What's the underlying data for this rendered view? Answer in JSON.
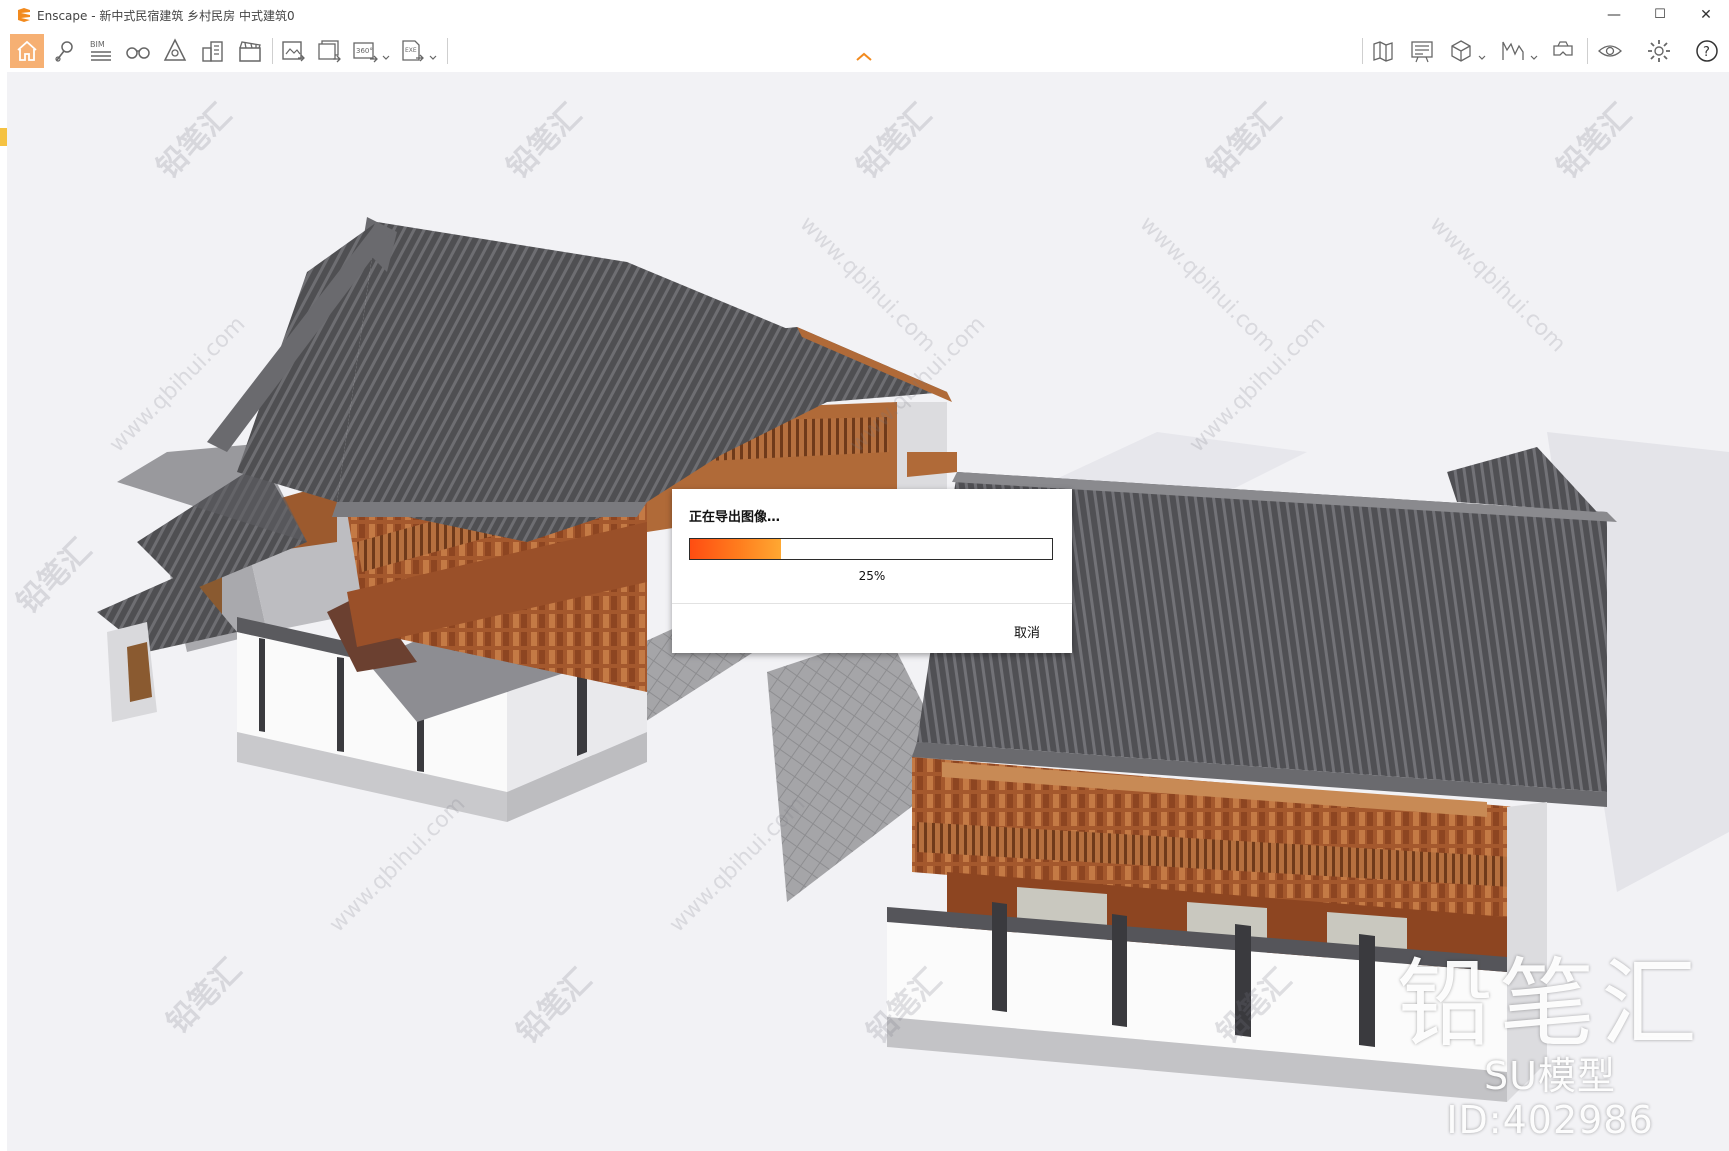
{
  "window": {
    "title": "Enscape - 新中式民宿建筑 乡村民房 中式建筑0",
    "minimize_glyph": "—",
    "maximize_glyph": "☐",
    "close_glyph": "✕"
  },
  "toolbar": {
    "items": [
      {
        "name": "home-button",
        "icon": "home-icon",
        "active": true
      },
      {
        "name": "views-button",
        "icon": "location-pin-icon"
      },
      {
        "name": "bim-button",
        "icon": "bim-icon",
        "label": "BIM"
      },
      {
        "name": "walk-mode-button",
        "icon": "binoculars-icon"
      },
      {
        "name": "asset-library-button",
        "icon": "library-icon"
      },
      {
        "name": "buildings-button",
        "icon": "buildings-icon"
      },
      {
        "name": "video-editor-button",
        "icon": "clapper-icon"
      },
      {
        "name": "screenshot-button",
        "icon": "image-export-icon"
      },
      {
        "name": "batch-render-button",
        "icon": "batch-render-icon"
      },
      {
        "name": "panorama-button",
        "icon": "panorama-360-icon",
        "label": "360°"
      },
      {
        "name": "export-exe-button",
        "icon": "exe-export-icon",
        "label": "EXE"
      },
      {
        "name": "map-button",
        "icon": "map-icon"
      },
      {
        "name": "presentation-button",
        "icon": "presentation-icon"
      },
      {
        "name": "view-cube-button",
        "icon": "cube-icon"
      },
      {
        "name": "chart-button",
        "icon": "chart-icon"
      },
      {
        "name": "vr-button",
        "icon": "vr-headset-icon"
      },
      {
        "name": "visibility-button",
        "icon": "eye-icon"
      },
      {
        "name": "settings-button",
        "icon": "gear-icon"
      },
      {
        "name": "help-button",
        "icon": "help-icon",
        "label": "?"
      }
    ],
    "accent": "#f28a1e"
  },
  "dialog": {
    "title": "正在导出图像…",
    "progress": 0.25,
    "progress_label": "25%",
    "cancel_label": "取消"
  },
  "watermark": {
    "brand": "铅笔汇",
    "model_id": "SU模型ID:402986",
    "pattern_text": "铅笔汇",
    "url_text": "www.qbihui.com"
  }
}
